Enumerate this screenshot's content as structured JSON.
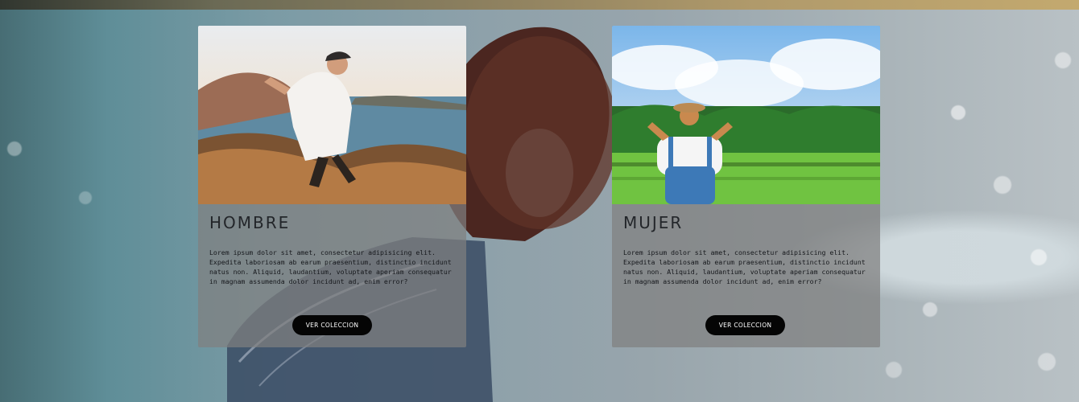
{
  "cards": [
    {
      "title": "HOMBRE",
      "description": "Lorem ipsum dolor sit amet, consectetur adipisicing elit. Expedita laboriosam ab earum praesentium, distinctio incidunt natus non. Aliquid, laudantium, voluptate aperiam consequatur in magnam assumenda dolor incidunt ad, enim error?",
      "button_label": "VER COLECCION"
    },
    {
      "title": "MUJER",
      "description": "Lorem ipsum dolor sit amet, consectetur adipisicing elit. Expedita laboriosam ab earum praesentium, distinctio incidunt natus non. Aliquid, laudantium, voluptate aperiam consequatur in magnam assumenda dolor incidunt ad, enim error?",
      "button_label": "VER COLECCION"
    }
  ]
}
